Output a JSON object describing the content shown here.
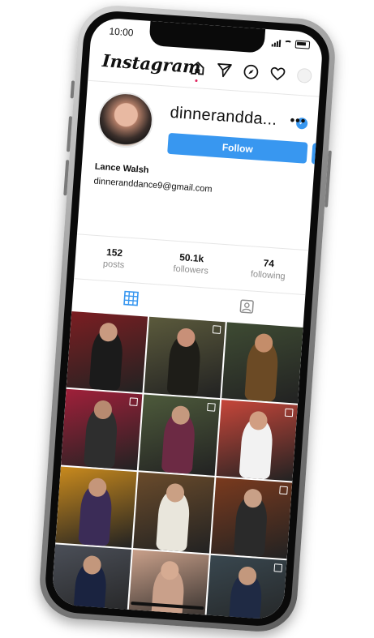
{
  "status": {
    "time": "10:00"
  },
  "app": {
    "name": "Instagram"
  },
  "nav_icons": [
    "home-icon",
    "direct-message-icon",
    "explore-icon",
    "activity-heart-icon",
    "profile-avatar-icon"
  ],
  "profile": {
    "username": "dinnerandda...",
    "more": "•••",
    "follow_label": "Follow",
    "dropdown": "⌄",
    "full_name": "Lance Walsh",
    "email": "dinneranddance9@gmail.com",
    "verified": "✓"
  },
  "stats": [
    {
      "value": "152",
      "label": "posts"
    },
    {
      "value": "50.1k",
      "label": "followers"
    },
    {
      "value": "74",
      "label": "following"
    }
  ],
  "tabs": [
    "grid-icon",
    "tagged-icon"
  ],
  "colors": {
    "accent": "#3897f0",
    "notification": "#e0245e"
  },
  "grid": [
    {
      "bg": "#7b1e22",
      "fig": "#1b1b1b",
      "skin": "#c99a80",
      "multi": false
    },
    {
      "bg": "#5b5a3c",
      "fig": "#1e1d18",
      "skin": "#c89078",
      "multi": true
    },
    {
      "bg": "#3e4b33",
      "fig": "#6b4a25",
      "skin": "#c48d6a",
      "multi": false
    },
    {
      "bg": "#a0203a",
      "fig": "#2e2e2e",
      "skin": "#b78a70",
      "multi": true
    },
    {
      "bg": "#4d5a3b",
      "fig": "#6c2a44",
      "skin": "#c5997e",
      "multi": true
    },
    {
      "bg": "#c6463a",
      "fig": "#f2f2f2",
      "skin": "#d19e82",
      "multi": true
    },
    {
      "bg": "#c98a1d",
      "fig": "#3b2c57",
      "skin": "#c5967a",
      "multi": false
    },
    {
      "bg": "#6a4b2b",
      "fig": "#e9e6dc",
      "skin": "#caa084",
      "multi": false
    },
    {
      "bg": "#7a3a1e",
      "fig": "#2a2a2a",
      "skin": "#c9a087",
      "multi": true
    },
    {
      "bg": "#4b4f58",
      "fig": "#1a2340",
      "skin": "#c3977c",
      "multi": false
    },
    {
      "bg": "#c9a08a",
      "fig": "#c9a08a",
      "skin": "#d6ab92",
      "multi": false
    },
    {
      "bg": "#39474f",
      "fig": "#1f2a44",
      "skin": "#c3987d",
      "multi": true
    }
  ]
}
